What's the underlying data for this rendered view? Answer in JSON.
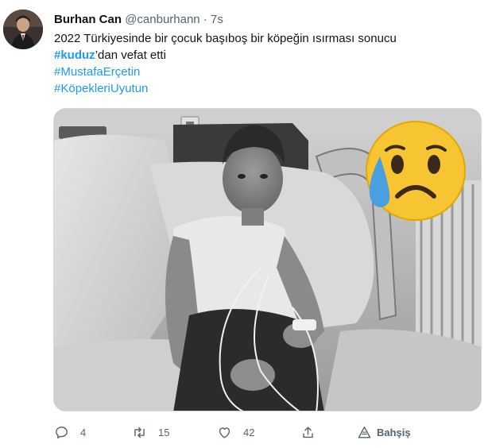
{
  "tweet": {
    "author_name": "Burhan Can",
    "author_handle": "@canburhann",
    "separator": "·",
    "time": "7s",
    "text_line1": "2022 Türkiyesinde bir çocuk başıboş bir köpeğin ısırması sonucu",
    "hashtag_kuduz": "#kuduz",
    "text_line2_rest": "’dan vefat etti",
    "hashtag_2": "#MustafaErçetin",
    "hashtag_3": "#KöpekleriUyutun"
  },
  "media": {
    "description_icon": "sad-crying-face-emoji",
    "style": "black-and-white photo"
  },
  "actions": {
    "reply_count": "4",
    "retweet_count": "15",
    "like_count": "42",
    "promote_label": "Bahşiş"
  },
  "icons": {
    "reply": "reply-icon",
    "retweet": "retweet-icon",
    "like": "heart-icon",
    "share": "share-icon",
    "tip": "tip-icon"
  },
  "colors": {
    "link": "#1d9bf0",
    "secondary_text": "#536471",
    "primary_text": "#0f1419",
    "emoji_yellow": "#f7c531",
    "tear_blue": "#4a9fe0"
  }
}
